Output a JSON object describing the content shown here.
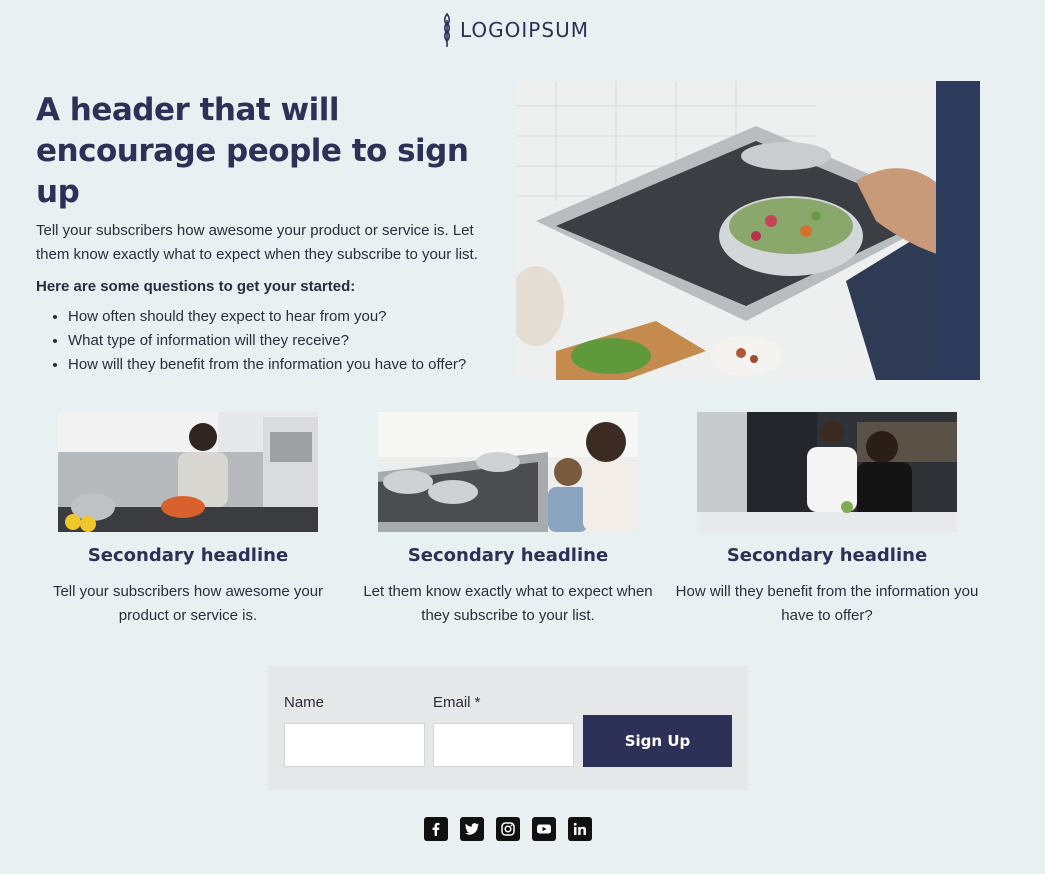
{
  "logo": {
    "text": "LOGOIPSUM",
    "icon": "wheat-icon",
    "color": "#2d3057"
  },
  "hero": {
    "title": "A header that will encourage people to sign up",
    "body": "Tell your subscribers how awesome your product or service is. Let them know exactly what to expect when they subscribe to your list.",
    "questions_heading": "Here are some questions to get your started:",
    "questions": [
      "How often should they expect to hear from you?",
      "What type of information will they receive?",
      "How will they benefit from the information you have to offer?"
    ]
  },
  "cards": [
    {
      "headline": "Secondary headline",
      "body": "Tell your subscribers how awesome your product or service is."
    },
    {
      "headline": "Secondary headline",
      "body": "Let them know exactly what to expect when they subscribe to your list."
    },
    {
      "headline": "Secondary headline",
      "body": "How will they benefit from the information you have to offer?"
    }
  ],
  "form": {
    "name_label": "Name",
    "email_label": "Email *",
    "name_value": "",
    "email_value": "",
    "submit_label": "Sign Up"
  },
  "social": [
    "facebook-icon",
    "twitter-icon",
    "instagram-icon",
    "youtube-icon",
    "linkedin-icon"
  ],
  "colors": {
    "background": "#e9f0f2",
    "brand": "#2d3057",
    "form_bg": "#e6e7e9"
  }
}
